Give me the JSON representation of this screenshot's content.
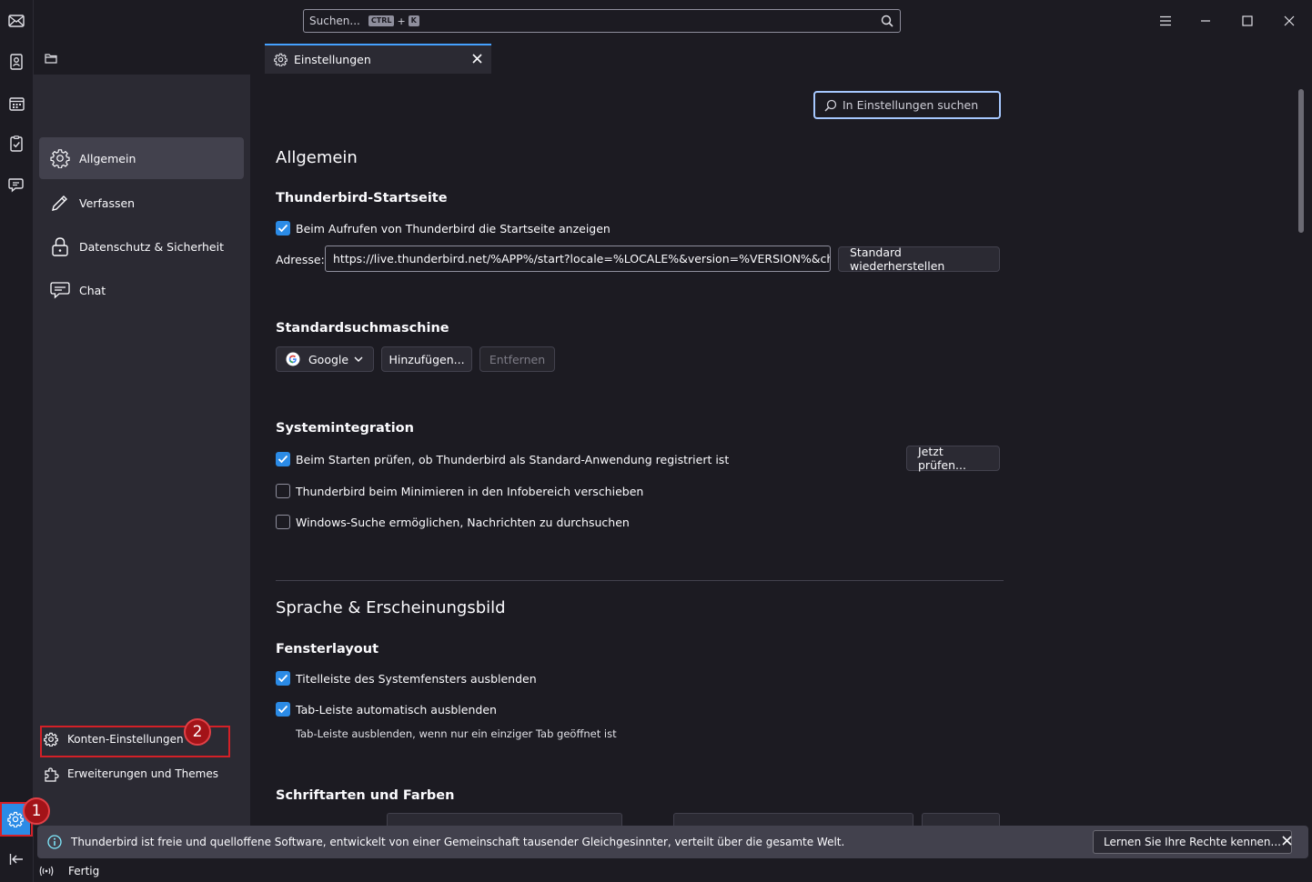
{
  "titlebar": {
    "search_placeholder": "Suchen...",
    "kbd_ctrl": "CTRL",
    "kbd_plus": "+",
    "kbd_key": "K"
  },
  "tab": {
    "label": "Einstellungen"
  },
  "sidebar": {
    "categories": [
      {
        "label": "Allgemein",
        "icon": "gear-icon",
        "selected": true
      },
      {
        "label": "Verfassen",
        "icon": "pencil-icon"
      },
      {
        "label": "Datenschutz & Sicherheit",
        "icon": "lock-icon"
      },
      {
        "label": "Chat",
        "icon": "chat-icon"
      }
    ],
    "footer": [
      {
        "label": "Konten-Einstellungen",
        "icon": "account-settings-icon"
      },
      {
        "label": "Erweiterungen und Themes",
        "icon": "puzzle-icon"
      }
    ]
  },
  "main": {
    "search_placeholder": "In Einstellungen suchen",
    "general_heading": "Allgemein",
    "startpage": {
      "heading": "Thunderbird-Startseite",
      "show_startpage_label": "Beim Aufrufen von Thunderbird die Startseite anzeigen",
      "show_startpage_checked": true,
      "address_label": "Adresse:",
      "address_value": "https://live.thunderbird.net/%APP%/start?locale=%LOCALE%&version=%VERSION%&channe",
      "restore_button": "Standard wiederherstellen"
    },
    "searchengine": {
      "heading": "Standardsuchmaschine",
      "selected": "Google",
      "add_button": "Hinzufügen...",
      "remove_button": "Entfernen"
    },
    "system": {
      "heading": "Systemintegration",
      "items": [
        {
          "label": "Beim Starten prüfen, ob Thunderbird als Standard-Anwendung registriert ist",
          "checked": true
        },
        {
          "label": "Thunderbird beim Minimieren in den Infobereich verschieben",
          "checked": false
        },
        {
          "label": "Windows-Suche ermöglichen, Nachrichten zu durchsuchen",
          "checked": false
        }
      ],
      "check_now_button": "Jetzt prüfen..."
    },
    "appearance_heading": "Sprache & Erscheinungsbild",
    "window_layout": {
      "heading": "Fensterlayout",
      "items": [
        {
          "label": "Titelleiste des Systemfensters ausblenden",
          "checked": true
        },
        {
          "label": "Tab-Leiste automatisch ausblenden",
          "checked": true
        }
      ],
      "hint": "Tab-Leiste ausblenden, wenn nur ein einziger Tab geöffnet ist"
    },
    "fonts_heading": "Schriftarten und Farben"
  },
  "notification": {
    "text": "Thunderbird ist freie und quelloffene Software, entwickelt von einer Gemeinschaft tausender Gleichgesinnter, verteilt über die gesamte Welt.",
    "button": "Lernen Sie Ihre Rechte kennen..."
  },
  "status": {
    "text": "Fertig"
  },
  "annotations": {
    "badge1": "1",
    "badge2": "2"
  },
  "colors": {
    "accent": "#2b8be6",
    "marker": "#d42027"
  }
}
